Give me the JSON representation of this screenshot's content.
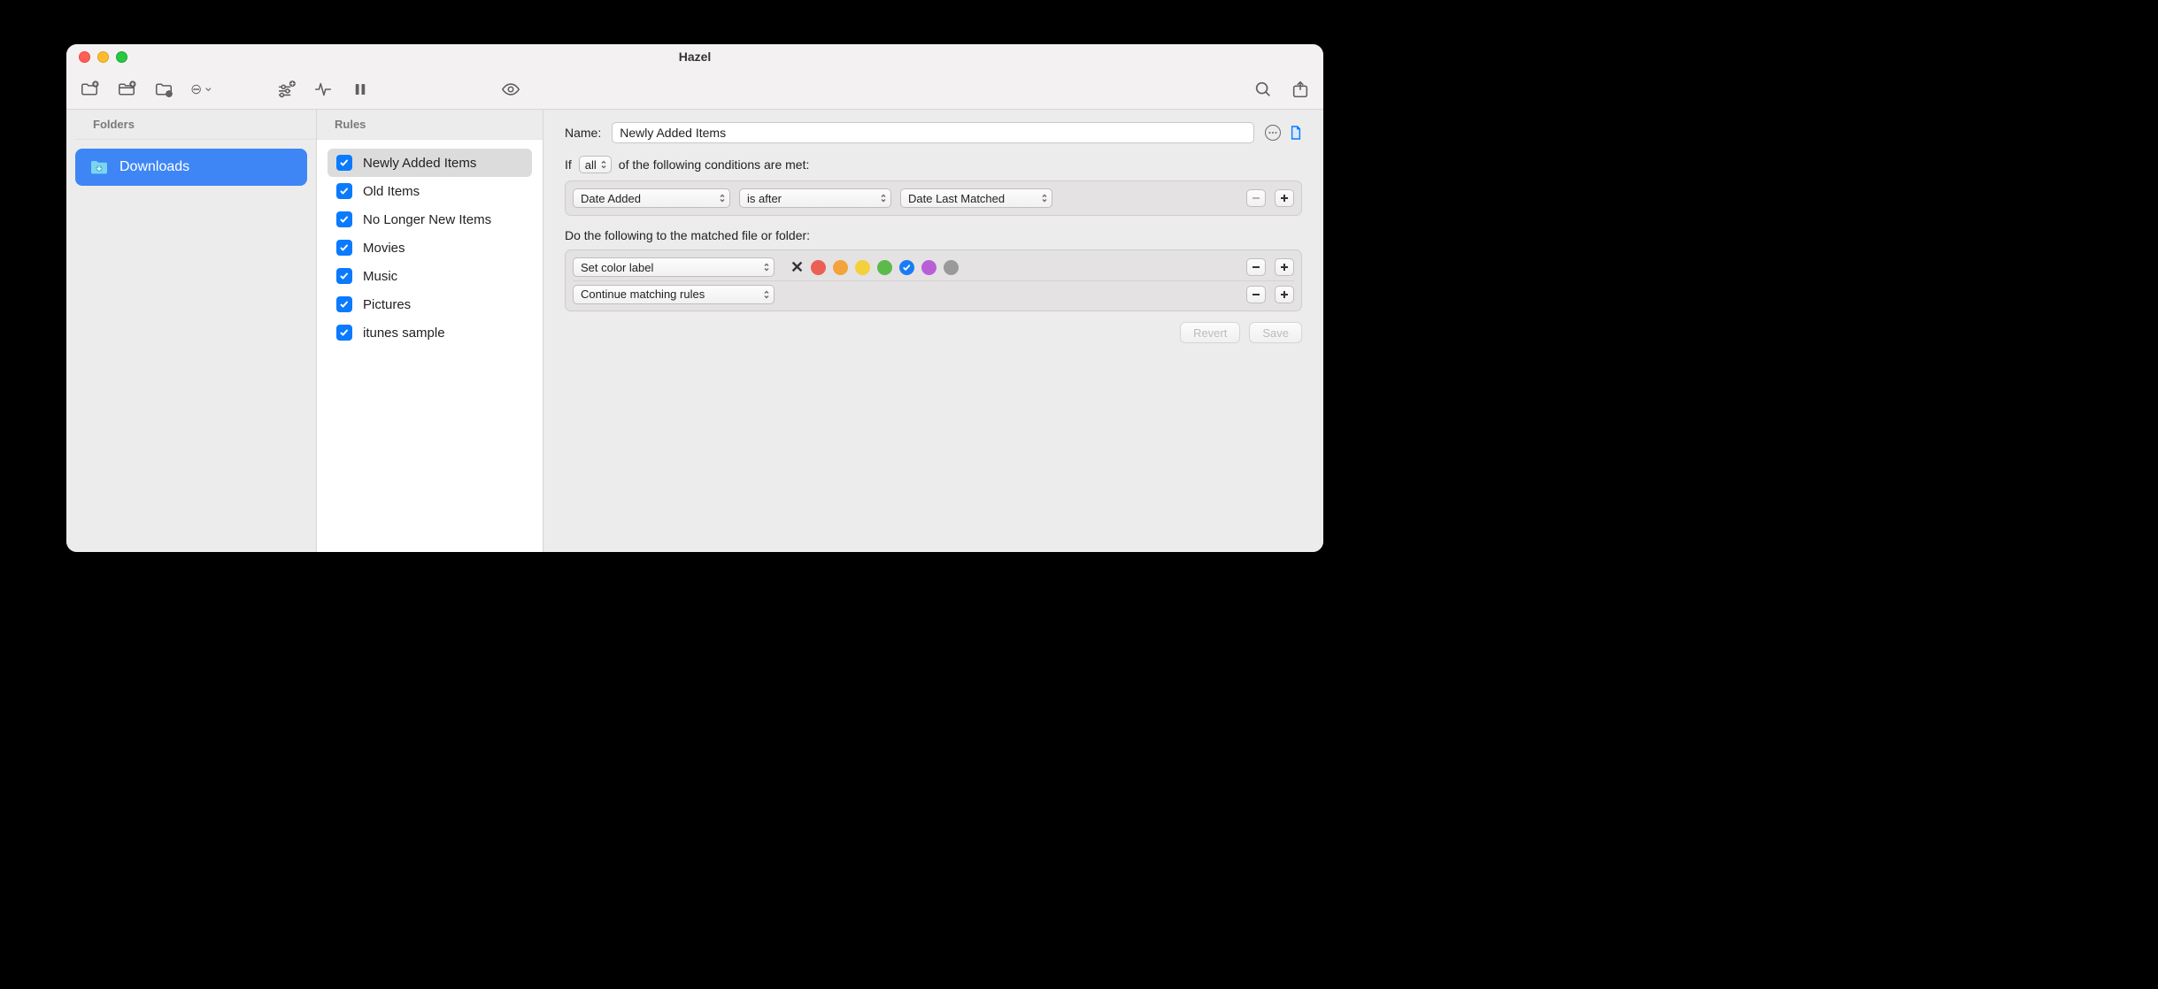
{
  "window": {
    "title": "Hazel"
  },
  "sidebars": {
    "folders_header": "Folders",
    "rules_header": "Rules"
  },
  "folders": [
    {
      "name": "Downloads",
      "selected": true
    }
  ],
  "rules": [
    {
      "name": "Newly Added Items",
      "checked": true,
      "selected": true
    },
    {
      "name": "Old Items",
      "checked": true,
      "selected": false
    },
    {
      "name": "No Longer New Items",
      "checked": true,
      "selected": false
    },
    {
      "name": "Movies",
      "checked": true,
      "selected": false
    },
    {
      "name": "Music",
      "checked": true,
      "selected": false
    },
    {
      "name": "Pictures",
      "checked": true,
      "selected": false
    },
    {
      "name": "itunes sample",
      "checked": true,
      "selected": false
    }
  ],
  "detail": {
    "name_label": "Name:",
    "name_value": "Newly Added Items",
    "if_prefix": "If",
    "if_scope": "all",
    "if_suffix": "of the following conditions are met:",
    "conditions": [
      {
        "attribute": "Date Added",
        "operator": "is after",
        "value": "Date Last Matched"
      }
    ],
    "do_label": "Do the following to the matched file or folder:",
    "actions": [
      {
        "type": "Set color label",
        "colors": [
          "none",
          "#ec5f55",
          "#f2a33c",
          "#f4d03c",
          "#5bba4b",
          "#1a7cf4",
          "#b85fd8",
          "#9a9a9a"
        ],
        "selected_color_index": 5
      },
      {
        "type": "Continue matching rules"
      }
    ],
    "buttons": {
      "revert": "Revert",
      "save": "Save"
    }
  }
}
